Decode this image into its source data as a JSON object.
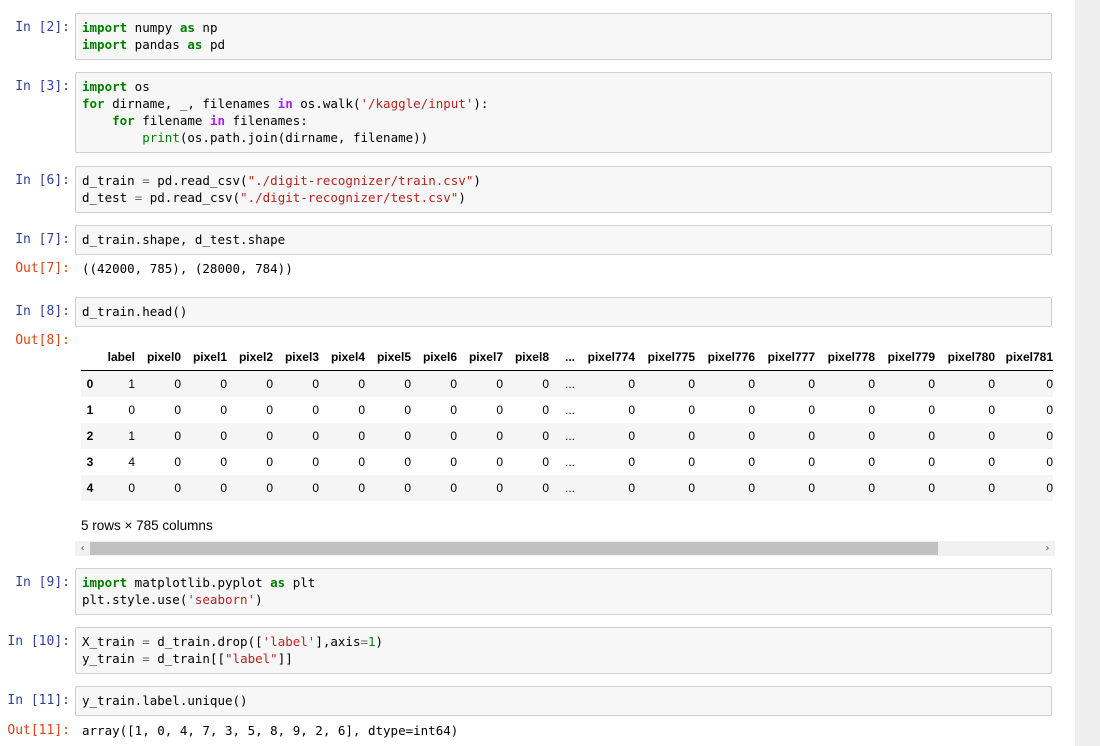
{
  "cells": [
    {
      "prompt": "In [2]:",
      "code_lines": [
        "import numpy as np",
        "import pandas as pd"
      ]
    },
    {
      "prompt": "In [3]:",
      "code_lines": [
        "import os",
        "for dirname, _, filenames in os.walk('/kaggle/input'):",
        "    for filename in filenames:",
        "        print(os.path.join(dirname, filename))"
      ]
    },
    {
      "prompt": "In [6]:",
      "code_lines": [
        "d_train = pd.read_csv(\"./digit-recognizer/train.csv\")",
        "d_test = pd.read_csv(\"./digit-recognizer/test.csv\")"
      ]
    },
    {
      "prompt": "In [7]:",
      "code_lines": [
        "d_train.shape, d_test.shape"
      ],
      "out_prompt": "Out[7]:",
      "output": "((42000, 785), (28000, 784))"
    },
    {
      "prompt": "In [8]:",
      "code_lines": [
        "d_train.head()"
      ],
      "out_prompt": "Out[8]:"
    },
    {
      "prompt": "In [9]:",
      "code_lines": [
        "import matplotlib.pyplot as plt",
        "plt.style.use('seaborn')"
      ]
    },
    {
      "prompt": "In [10]:",
      "code_lines": [
        "X_train = d_train.drop(['label'],axis=1)",
        "y_train = d_train[[\"label\"]]"
      ]
    },
    {
      "prompt": "In [11]:",
      "code_lines": [
        "y_train.label.unique()"
      ],
      "out_prompt": "Out[11]:",
      "output": "array([1, 0, 4, 7, 3, 5, 8, 9, 2, 6], dtype=int64)"
    }
  ],
  "dataframe": {
    "columns": [
      "",
      "label",
      "pixel0",
      "pixel1",
      "pixel2",
      "pixel3",
      "pixel4",
      "pixel5",
      "pixel6",
      "pixel7",
      "pixel8",
      "...",
      "pixel774",
      "pixel775",
      "pixel776",
      "pixel777",
      "pixel778",
      "pixel779",
      "pixel780",
      "pixel781"
    ],
    "rows": [
      [
        "0",
        "1",
        "0",
        "0",
        "0",
        "0",
        "0",
        "0",
        "0",
        "0",
        "0",
        "...",
        "0",
        "0",
        "0",
        "0",
        "0",
        "0",
        "0",
        "0"
      ],
      [
        "1",
        "0",
        "0",
        "0",
        "0",
        "0",
        "0",
        "0",
        "0",
        "0",
        "0",
        "...",
        "0",
        "0",
        "0",
        "0",
        "0",
        "0",
        "0",
        "0"
      ],
      [
        "2",
        "1",
        "0",
        "0",
        "0",
        "0",
        "0",
        "0",
        "0",
        "0",
        "0",
        "...",
        "0",
        "0",
        "0",
        "0",
        "0",
        "0",
        "0",
        "0"
      ],
      [
        "3",
        "4",
        "0",
        "0",
        "0",
        "0",
        "0",
        "0",
        "0",
        "0",
        "0",
        "...",
        "0",
        "0",
        "0",
        "0",
        "0",
        "0",
        "0",
        "0"
      ],
      [
        "4",
        "0",
        "0",
        "0",
        "0",
        "0",
        "0",
        "0",
        "0",
        "0",
        "0",
        "...",
        "0",
        "0",
        "0",
        "0",
        "0",
        "0",
        "0",
        "0"
      ]
    ],
    "row_count_text": "5 rows × 785 columns"
  },
  "scrollbar": {
    "left_arrow": "‹",
    "right_arrow": "›"
  }
}
